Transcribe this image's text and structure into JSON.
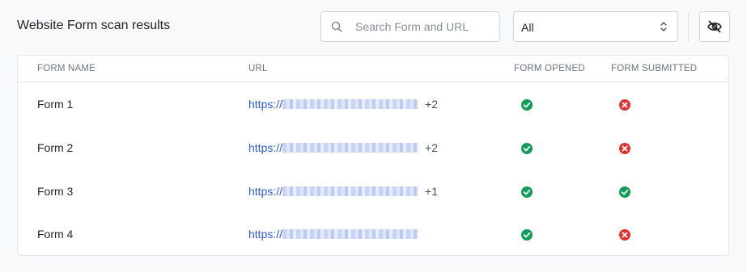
{
  "header": {
    "title": "Website Form scan results",
    "search_placeholder": "Search Form and URL",
    "filter_value": "All"
  },
  "table": {
    "columns": [
      "FORM NAME",
      "URL",
      "FORM OPENED",
      "FORM SUBMITTED"
    ],
    "rows": [
      {
        "name": "Form 1",
        "url_prefix": "https://",
        "more": "+2",
        "opened": "success",
        "submitted": "failure"
      },
      {
        "name": "Form 2",
        "url_prefix": "https://",
        "more": "+2",
        "opened": "success",
        "submitted": "failure"
      },
      {
        "name": "Form 3",
        "url_prefix": "https://",
        "more": "+1",
        "opened": "success",
        "submitted": "success"
      },
      {
        "name": "Form 4",
        "url_prefix": "https://",
        "more": "",
        "opened": "success",
        "submitted": "failure"
      }
    ]
  },
  "colors": {
    "success": "#0f9d58",
    "failure": "#e03131",
    "link": "#2e5bd6"
  },
  "icons": {
    "search": "search-icon",
    "select": "chevron-up-down-icon",
    "visibility": "eye-off-icon",
    "success": "check-circle-icon",
    "failure": "x-circle-icon"
  }
}
